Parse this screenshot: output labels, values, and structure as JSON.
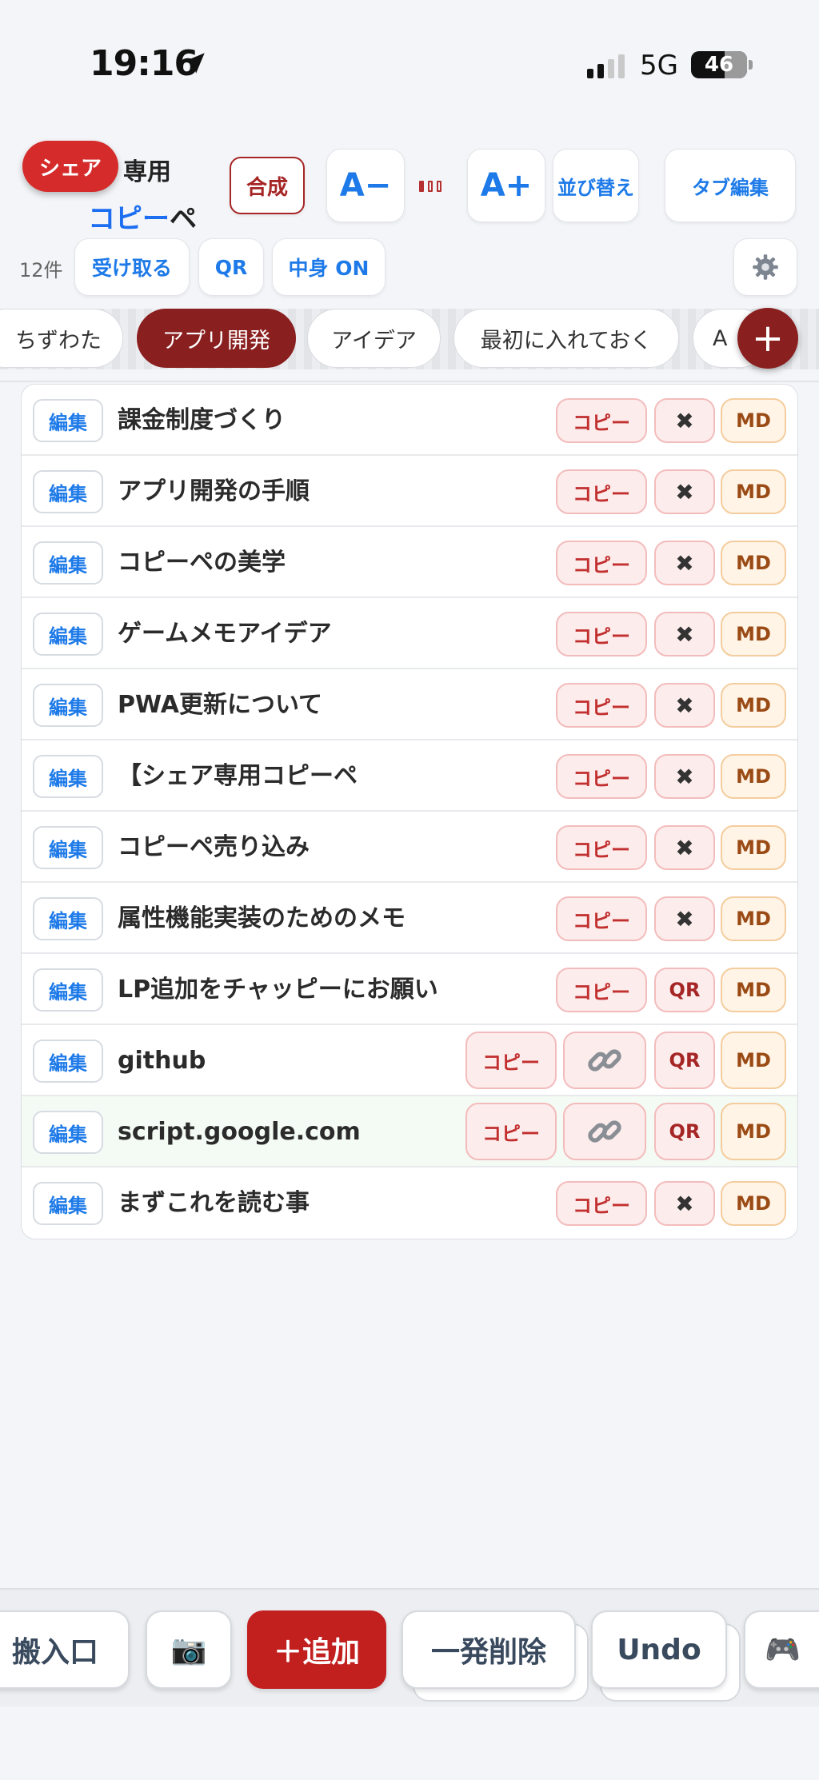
{
  "status_bar": {
    "time": "19:16",
    "network": "5G",
    "battery": "46",
    "signal_level": 0.5
  },
  "header": {
    "share_badge": "シェア",
    "title_line1": "専用",
    "title_line2_blue": "コピー",
    "title_line2_dark": "ペ",
    "merge_label": "合成",
    "font_minus_label": "A−",
    "font_plus_label": "A+",
    "sort_label": "並び替え",
    "tab_edit_label": "タブ編集",
    "count_label": "12件",
    "receive_label": "受け取る",
    "qr_label": "QR",
    "content_toggle_label": "中身 ON"
  },
  "tabs": [
    {
      "label": "ちずわた",
      "active": false
    },
    {
      "label": "アプリ開発",
      "active": true
    },
    {
      "label": "アイデア",
      "active": false
    },
    {
      "label": "最初に入れておく",
      "active": false
    },
    {
      "label": "A",
      "active": false
    }
  ],
  "add_tab_label": "+",
  "items": [
    {
      "edit": "編集",
      "title": "課金制度づくり",
      "copy": "コピー",
      "action": "✖",
      "md": "MD"
    },
    {
      "edit": "編集",
      "title": "アプリ開発の手順",
      "copy": "コピー",
      "action": "✖",
      "md": "MD"
    },
    {
      "edit": "編集",
      "title": "コピーペの美学",
      "copy": "コピー",
      "action": "✖",
      "md": "MD"
    },
    {
      "edit": "編集",
      "title": "ゲームメモアイデア",
      "copy": "コピー",
      "action": "✖",
      "md": "MD"
    },
    {
      "edit": "編集",
      "title": "PWA更新について",
      "copy": "コピー",
      "action": "✖",
      "md": "MD"
    },
    {
      "edit": "編集",
      "title": "【シェア専用コピーペ",
      "copy": "コピー",
      "action": "✖",
      "md": "MD"
    },
    {
      "edit": "編集",
      "title": "コピーペ売り込み",
      "copy": "コピー",
      "action": "✖",
      "md": "MD"
    },
    {
      "edit": "編集",
      "title": "属性機能実装のためのメモ",
      "copy": "コピー",
      "action": "✖",
      "md": "MD"
    },
    {
      "edit": "編集",
      "title": "LP追加をチャッピーにお願い",
      "copy": "コピー",
      "action": "QR",
      "md": "MD"
    },
    {
      "edit": "編集",
      "title": "github",
      "copy": "コピー",
      "link": "link-icon",
      "action": "QR",
      "md": "MD"
    },
    {
      "edit": "編集",
      "title": "script.google.com",
      "copy": "コピー",
      "link": "link-icon",
      "action": "QR",
      "md": "MD"
    },
    {
      "edit": "編集",
      "title": "まずこれを読む事",
      "copy": "コピー",
      "action": "✖",
      "md": "MD"
    }
  ],
  "toolbar": {
    "import_label": "搬入口",
    "camera_icon": "📷",
    "add_label": "＋追加",
    "delete_all_label": "一発削除",
    "undo_label": "Undo",
    "game_icon": "🎮"
  },
  "colors": {
    "accent_blue": "#1d7ae8",
    "brand_red": "#8a1f1f",
    "add_red": "#c21f1f"
  }
}
